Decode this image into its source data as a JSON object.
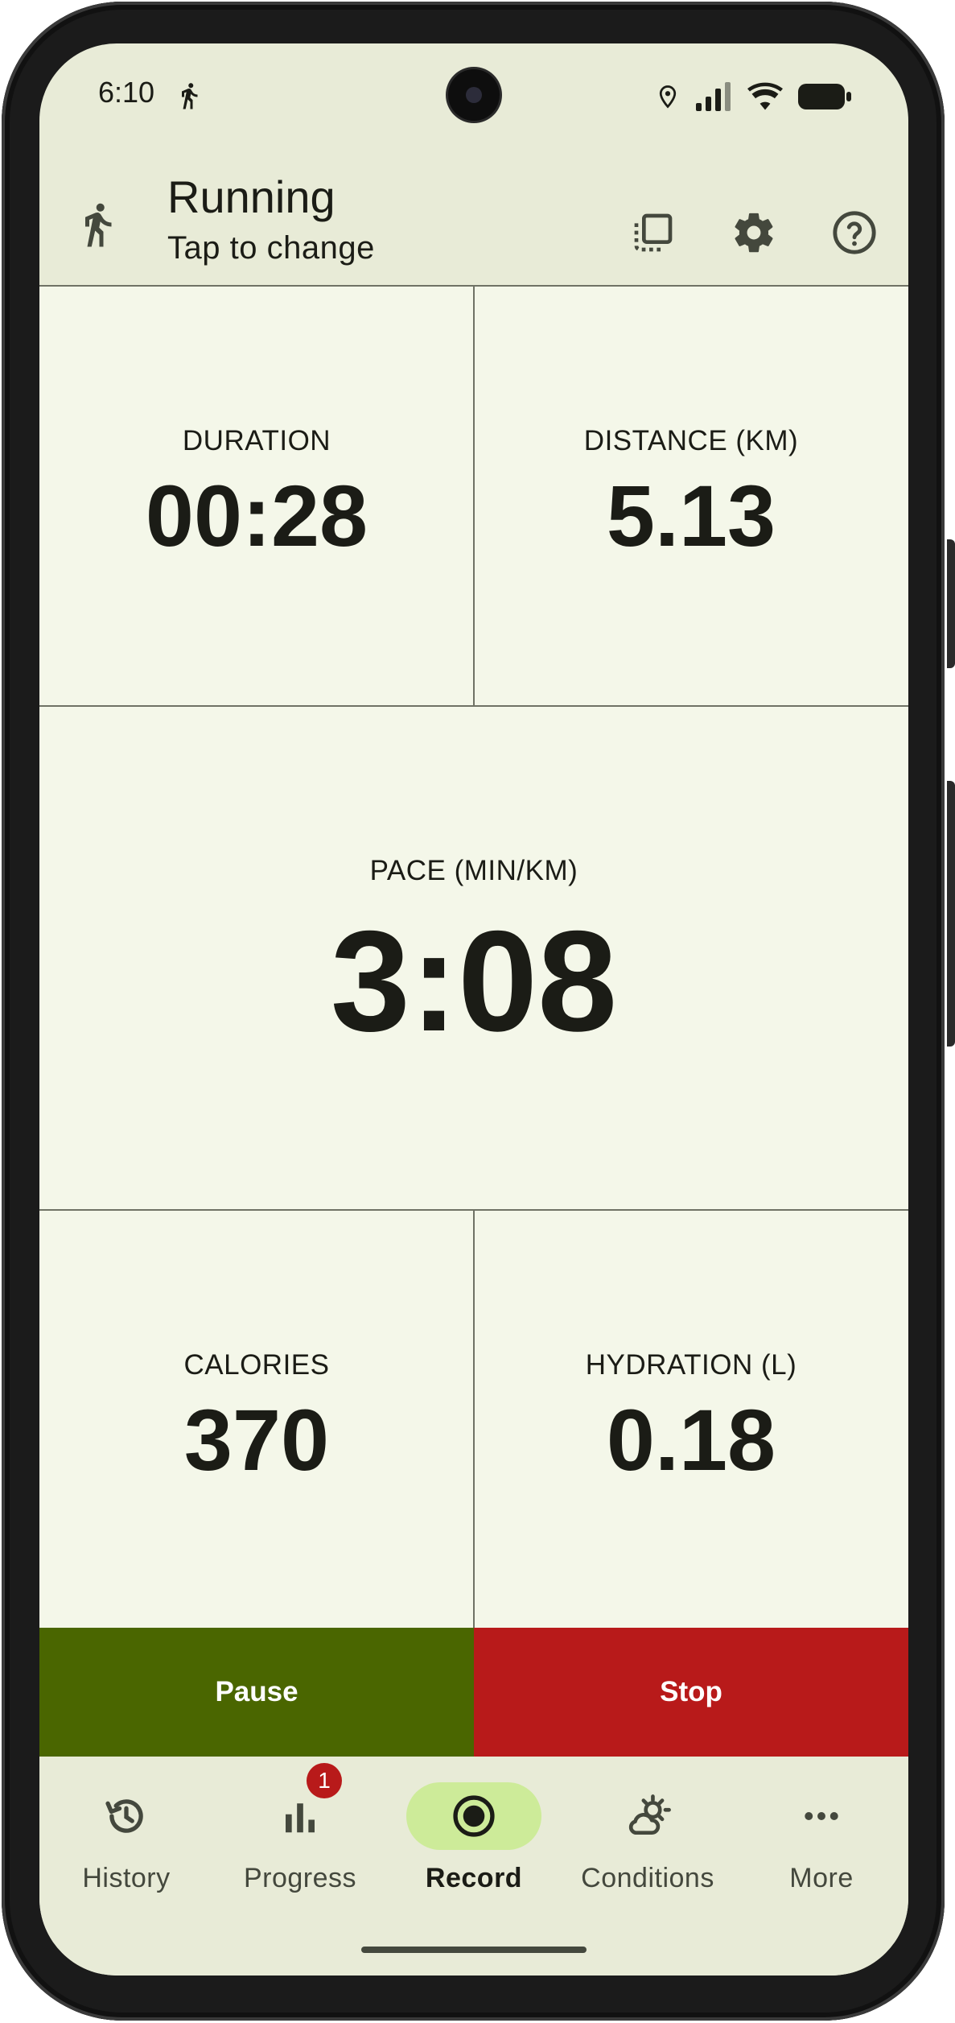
{
  "status_bar": {
    "time": "6:10",
    "icons": [
      "running-person-icon",
      "location-icon",
      "signal-icon",
      "wifi-icon",
      "battery-icon"
    ]
  },
  "app_bar": {
    "activity_icon": "running-person-icon",
    "title": "Running",
    "subtitle": "Tap to change",
    "actions": [
      "select-layout-icon",
      "settings-gear-icon",
      "help-icon"
    ]
  },
  "stats": {
    "duration": {
      "label": "DURATION",
      "value": "00:28"
    },
    "distance": {
      "label": "DISTANCE (KM)",
      "value": "5.13"
    },
    "pace": {
      "label": "PACE (MIN/KM)",
      "value": "3:08"
    },
    "calories": {
      "label": "CALORIES",
      "value": "370"
    },
    "hydration": {
      "label": "HYDRATION (L)",
      "value": "0.18"
    }
  },
  "controls": {
    "pause_label": "Pause",
    "stop_label": "Stop"
  },
  "bottom_nav": {
    "items": [
      {
        "label": "History",
        "icon": "history-icon",
        "selected": false
      },
      {
        "label": "Progress",
        "icon": "bar-chart-icon",
        "selected": false,
        "badge": "1"
      },
      {
        "label": "Record",
        "icon": "record-icon",
        "selected": true
      },
      {
        "label": "Conditions",
        "icon": "weather-conditions-icon",
        "selected": false
      },
      {
        "label": "More",
        "icon": "more-dots-icon",
        "selected": false
      }
    ]
  },
  "colors": {
    "background": "#e8ebd7",
    "surface": "#f4f7e9",
    "pause": "#4a6600",
    "stop": "#b81a1a",
    "nav_selected": "#cdeb99",
    "text": "#1b1c16"
  }
}
